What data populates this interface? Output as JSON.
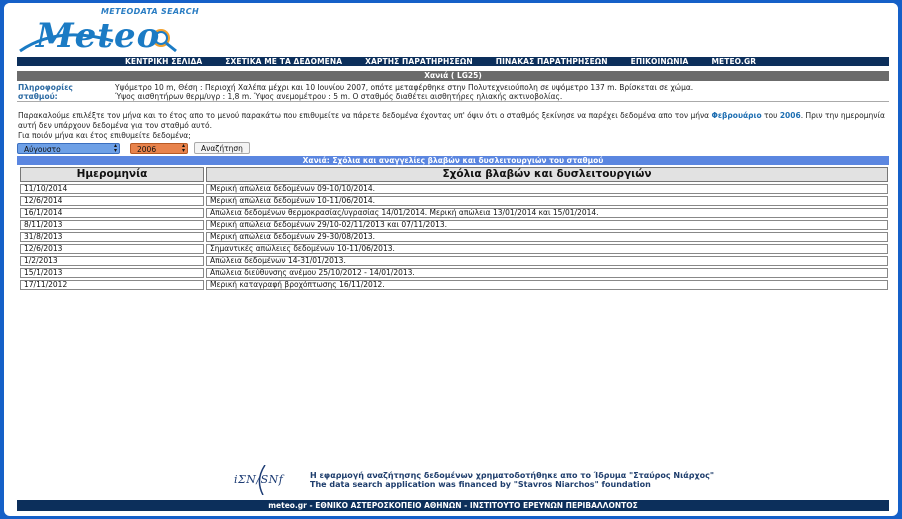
{
  "header": {
    "subtitle": "METEODATA SEARCH",
    "logo_text": "Meteo"
  },
  "nav": {
    "items": [
      "ΚΕΝΤΡΙΚΗ ΣΕΛΙΔΑ",
      "ΣΧΕΤΙΚΑ ΜΕ ΤΑ ΔΕΔΟΜΕΝΑ",
      "ΧΑΡΤΗΣ ΠΑΡΑΤΗΡΗΣΕΩΝ",
      "ΠΙΝΑΚΑΣ ΠΑΡΑΤΗΡΗΣΕΩΝ",
      "ΕΠΙΚΟΙΝΩΝΙΑ",
      "METEO.GR"
    ]
  },
  "station": {
    "title": "Χανιά ( LG25)",
    "info_label_1": "Πληροφορίες",
    "info_label_2": "σταθμού:",
    "info_line_1": "Υψόμετρο 10 m, Θέση : Περιοχή Χαλέπα μέχρι και 10 Ιουνίου 2007, οπότε μεταφέρθηκε στην Πολυτεχνειούπολη σε υψόμετρο 137 m. Βρίσκεται σε χώμα.",
    "info_line_2": "Ύψος αισθητήρων θερμ/υγρ : 1,8 m. Ύψος ανεμομέτρου : 5 m. Ο σταθμός διαθέτει αισθητήρες ηλιακής ακτινοβολίας."
  },
  "intro": {
    "part_1": "Παρακαλούμε επιλέξτε τον μήνα και το έτος απο το μενού παρακάτω που επιθυμείτε να πάρετε δεδομένα έχοντας υπ' όψιν ότι ο σταθμός ξεκίνησε να παρέχει δεδομένα απο τον μήνα ",
    "month": "Φεβρουάριο",
    "part_2": " του ",
    "year": "2006",
    "part_3": ". Πριν την ημερομηνία αυτή δεν υπάρχουν δεδομένα για τον σταθμό αυτό.",
    "question": "Για ποιόν μήνα και έτος επιθυμείτε δεδομένα;"
  },
  "controls": {
    "month_value": "Αύγουστο",
    "year_value": "2006",
    "search_label": "Αναζήτηση",
    "month_color": "#6ea0e6",
    "year_color": "#e8834c"
  },
  "table": {
    "caption": "Χανιά: Σχόλια και αναγγελίες βλαβών και δυσλειτουργιών του σταθμού",
    "headers": [
      "Ημερομηνία",
      "Σχόλια βλαβών και δυσλειτουργιών"
    ],
    "rows": [
      [
        "11/10/2014",
        "Μερική απώλεια δεδομένων 09-10/10/2014."
      ],
      [
        "12/6/2014",
        "Μερική απώλεια δεδομένων 10-11/06/2014."
      ],
      [
        "16/1/2014",
        "Απώλεια δεδομένων θερμοκρασίας/υγρασίας 14/01/2014. Μερική απώλεια 13/01/2014 και 15/01/2014."
      ],
      [
        "8/11/2013",
        "Μερική απώλεια δεδομένων 29/10-02/11/2013 και 07/11/2013."
      ],
      [
        "31/8/2013",
        "Μερική απώλεια δεδομένων 29-30/08/2013."
      ],
      [
        "12/6/2013",
        "Σημαντικές απώλειες δεδομένων 10-11/06/2013."
      ],
      [
        "1/2/2013",
        "Απώλεια δεδομένων 14-31/01/2013."
      ],
      [
        "15/1/2013",
        "Απώλεια διεύθυνσης ανέμου 25/10/2012 - 14/01/2013."
      ],
      [
        "17/11/2012",
        "Μερική καταγραφή βροχόπτωσης 16/11/2012."
      ]
    ]
  },
  "footer": {
    "logo_text": "iΣΝ/SNf",
    "credit_gr": "Η εφαρμογή αναζήτησης δεδομένων χρηματοδοτήθηκε απο το Ίδρυμα \"Σταύρος Νιάρχος\"",
    "credit_en": "The data search application was financed by \"Stavros Niarchos\" foundation",
    "bar_text": "meteo.gr - ΕΘΝΙΚΟ ΑΣΤΕΡΟΣΚΟΠΕΙΟ ΑΘΗΝΩΝ - ΙΝΣΤΙΤΟΥΤΟ ΕΡΕΥΝΩΝ ΠΕΡΙΒΑΛΛΟΝΤΟΣ"
  }
}
